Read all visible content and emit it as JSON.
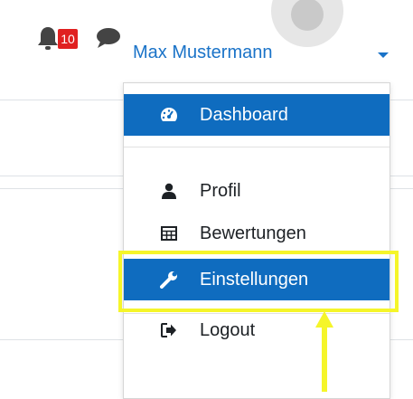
{
  "header": {
    "notification_count": "10",
    "user_name": "Max Mustermann",
    "icons": {
      "notifications": "bell-icon",
      "messages": "chat-bubble-icon",
      "menu_toggle": "caret-down-icon"
    }
  },
  "user_menu": {
    "items": [
      {
        "label": "Dashboard",
        "icon": "dashboard-gauge-icon",
        "active": true
      },
      {
        "label": "Profil",
        "icon": "user-icon",
        "active": false
      },
      {
        "label": "Bewertungen",
        "icon": "table-grid-icon",
        "active": false
      },
      {
        "label": "Einstellungen",
        "icon": "wrench-icon",
        "active": true
      },
      {
        "label": "Logout",
        "icon": "sign-out-icon",
        "active": false
      }
    ]
  },
  "colors": {
    "accent": "#0f6cbf",
    "link": "#1a73c8",
    "badge": "#e02020",
    "highlight": "#f5f52a"
  }
}
